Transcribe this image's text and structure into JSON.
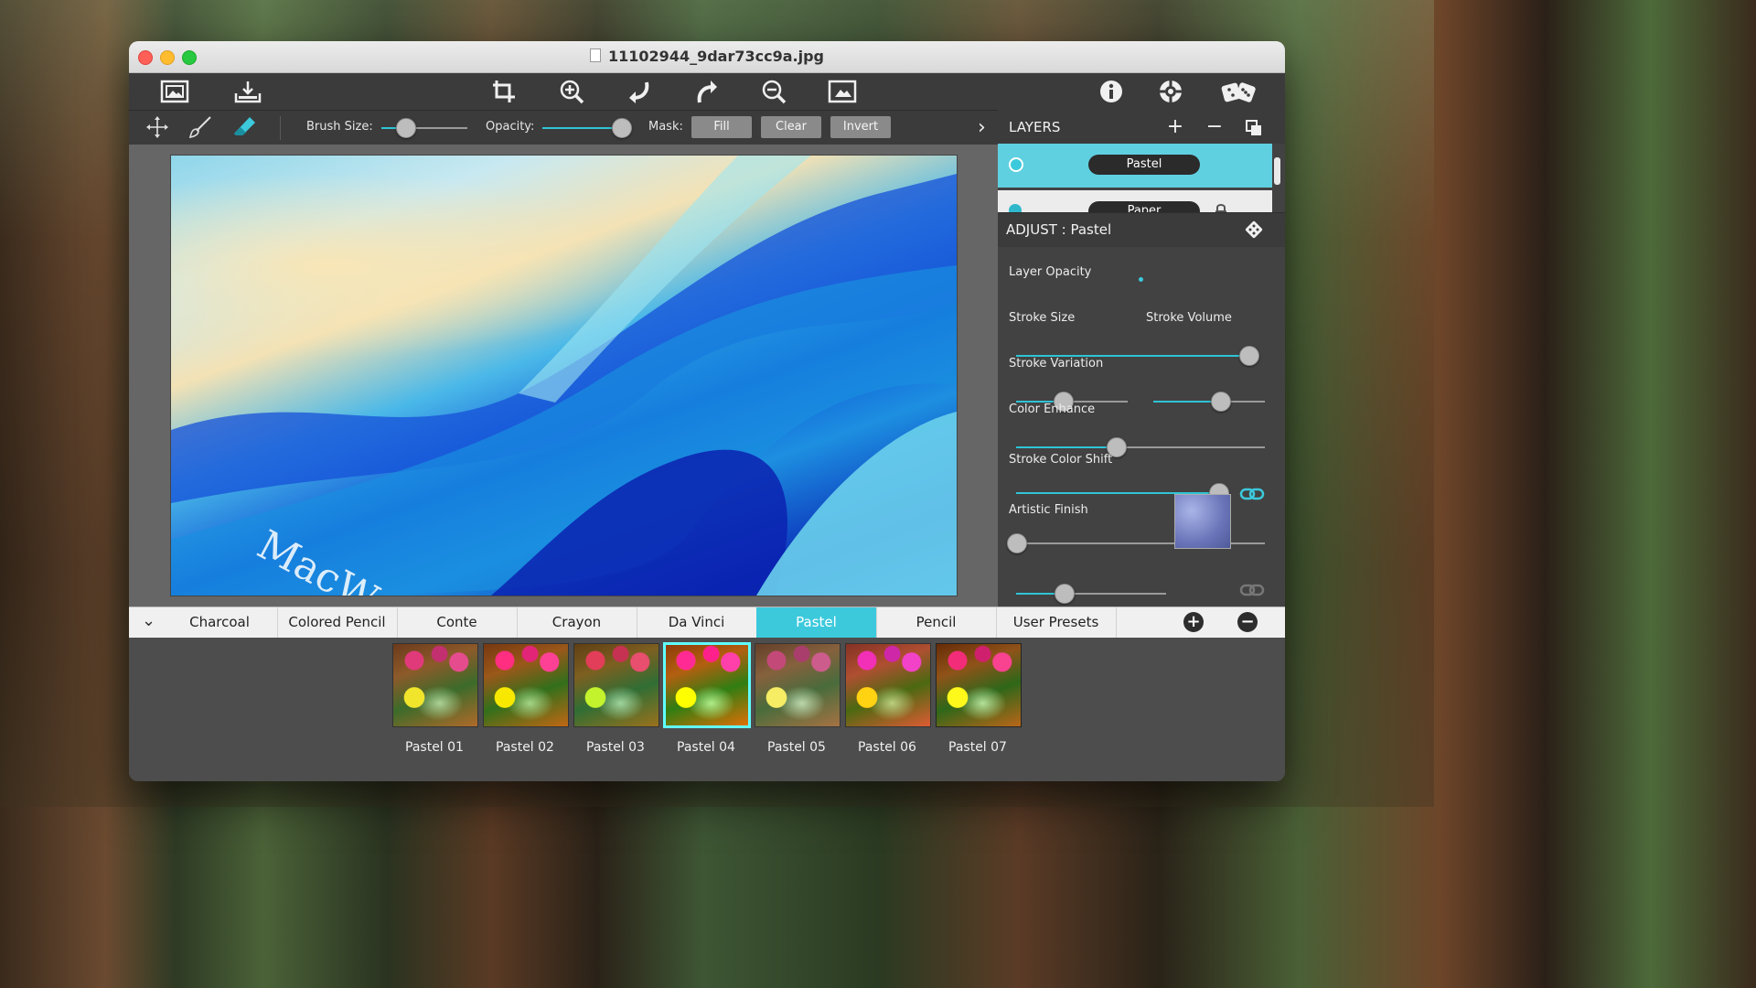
{
  "window": {
    "title": "11102944_9dar73cc9a.jpg"
  },
  "toolbar": {
    "icons": [
      "open-image-icon",
      "export-icon",
      "crop-icon",
      "zoom-in-icon",
      "undo-icon",
      "redo-icon",
      "zoom-out-icon",
      "fit-image-icon",
      "info-icon",
      "settings-icon",
      "randomize-icon"
    ]
  },
  "brush_bar": {
    "brush_size_label": "Brush Size:",
    "brush_size_value": 0.28,
    "opacity_label": "Opacity:",
    "opacity_value": 1.0,
    "mask_label": "Mask:",
    "mask_buttons": [
      "Fill",
      "Clear",
      "Invert"
    ]
  },
  "canvas": {
    "watermark": "MacW.com"
  },
  "layers": {
    "title": "LAYERS",
    "items": [
      {
        "name": "Pastel",
        "selected": true
      },
      {
        "name": "Paper",
        "selected": false,
        "locked": true
      }
    ]
  },
  "adjust": {
    "title": "ADJUST : Pastel",
    "sliders": [
      {
        "label": "Layer Opacity",
        "value": 0.97
      },
      {
        "label": "Stroke Size",
        "value": 0.42
      },
      {
        "label": "Stroke Volume",
        "value": 0.6
      },
      {
        "label": "Stroke Variation",
        "value": 0.4
      },
      {
        "label": "Color Enhance",
        "value": 0.95
      },
      {
        "label": "Stroke Color Shift",
        "value": 0.0
      },
      {
        "label": "Artistic Finish",
        "value": 0.32
      }
    ]
  },
  "style_tabs": {
    "tabs": [
      "Charcoal",
      "Colored Pencil",
      "Conte",
      "Crayon",
      "Da Vinci",
      "Pastel",
      "Pencil",
      "User Presets"
    ],
    "active": "Pastel"
  },
  "presets": {
    "items": [
      "Pastel 01",
      "Pastel 02",
      "Pastel 03",
      "Pastel 04",
      "Pastel 05",
      "Pastel 06",
      "Pastel 07"
    ],
    "selected": "Pastel 04"
  },
  "colors": {
    "accent": "#3cc9dc",
    "toolbar_bg": "#3b3b3b",
    "panel_bg": "#424242"
  }
}
